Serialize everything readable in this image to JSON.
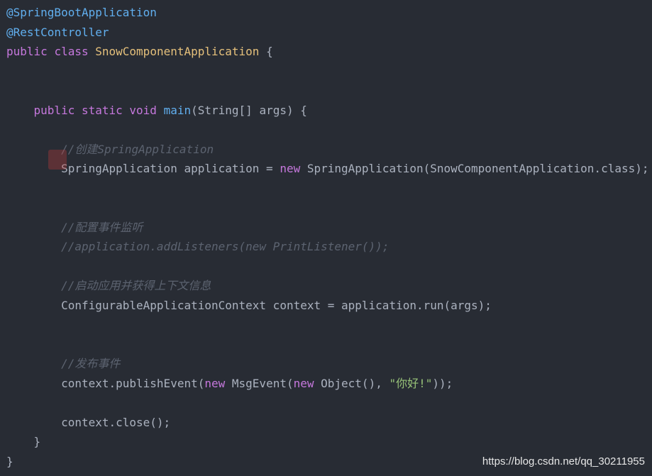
{
  "code": {
    "lines": [
      [
        {
          "t": "ann",
          "v": "@SpringBootApplication"
        }
      ],
      [
        {
          "t": "ann",
          "v": "@RestController"
        }
      ],
      [
        {
          "t": "kw",
          "v": "public"
        },
        {
          "t": "pl",
          "v": " "
        },
        {
          "t": "kw",
          "v": "class"
        },
        {
          "t": "pl",
          "v": " "
        },
        {
          "t": "cls",
          "v": "SnowComponentApplication"
        },
        {
          "t": "pl",
          "v": " {"
        }
      ],
      [],
      [],
      [
        {
          "t": "pl",
          "v": "    "
        },
        {
          "t": "kw",
          "v": "public"
        },
        {
          "t": "pl",
          "v": " "
        },
        {
          "t": "kw",
          "v": "static"
        },
        {
          "t": "pl",
          "v": " "
        },
        {
          "t": "kw",
          "v": "void"
        },
        {
          "t": "pl",
          "v": " "
        },
        {
          "t": "fn",
          "v": "main"
        },
        {
          "t": "pl",
          "v": "(String[] args) {"
        }
      ],
      [],
      [
        {
          "t": "pl",
          "v": "        "
        },
        {
          "t": "com",
          "v": "//创建SpringApplication"
        }
      ],
      [
        {
          "t": "pl",
          "v": "        SpringApplication application = "
        },
        {
          "t": "kw",
          "v": "new"
        },
        {
          "t": "pl",
          "v": " SpringApplication(SnowComponentApplication.class);"
        }
      ],
      [],
      [],
      [
        {
          "t": "pl",
          "v": "        "
        },
        {
          "t": "com",
          "v": "//配置事件监听"
        }
      ],
      [
        {
          "t": "pl",
          "v": "        "
        },
        {
          "t": "com",
          "v": "//application.addListeners(new PrintListener());"
        }
      ],
      [],
      [
        {
          "t": "pl",
          "v": "        "
        },
        {
          "t": "com",
          "v": "//启动应用并获得上下文信息"
        }
      ],
      [
        {
          "t": "pl",
          "v": "        ConfigurableApplicationContext context = application.run(args);"
        }
      ],
      [],
      [],
      [
        {
          "t": "pl",
          "v": "        "
        },
        {
          "t": "com",
          "v": "//发布事件"
        }
      ],
      [
        {
          "t": "pl",
          "v": "        context.publishEvent("
        },
        {
          "t": "kw",
          "v": "new"
        },
        {
          "t": "pl",
          "v": " MsgEvent("
        },
        {
          "t": "kw",
          "v": "new"
        },
        {
          "t": "pl",
          "v": " Object(), "
        },
        {
          "t": "str",
          "v": "\"你好!\""
        },
        {
          "t": "pl",
          "v": "));"
        }
      ],
      [],
      [
        {
          "t": "pl",
          "v": "        context.close();"
        }
      ],
      [
        {
          "t": "pl",
          "v": "    }"
        }
      ],
      [
        {
          "t": "pl",
          "v": "}"
        }
      ]
    ]
  },
  "colors": {
    "background": "#282c34",
    "annotation": "#61afef",
    "keyword": "#c678dd",
    "class": "#e5c07b",
    "function": "#61afef",
    "comment": "#5c6370",
    "string": "#98c379",
    "plain": "#abb2bf"
  },
  "watermark": {
    "text": "https://blog.csdn.net/qq_30211955"
  }
}
